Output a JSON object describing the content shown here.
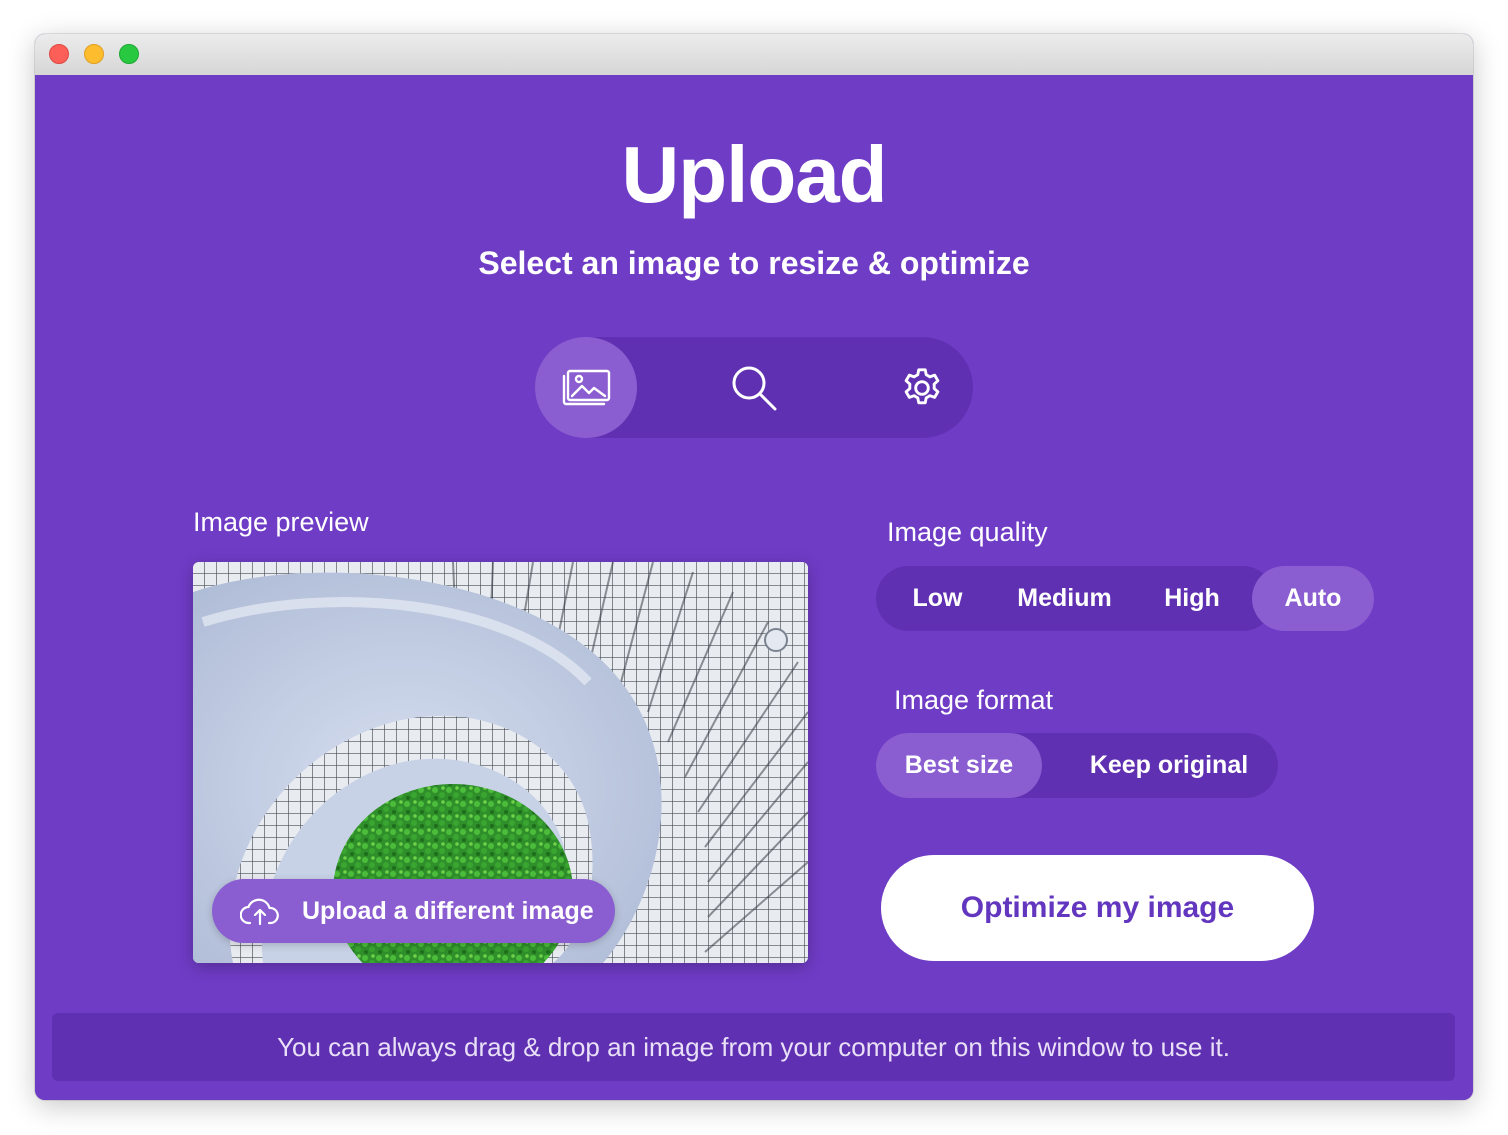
{
  "app": {
    "title": "Upload",
    "subtitle": "Select an image to resize & optimize"
  },
  "tabs": [
    {
      "icon": "image-gallery-icon",
      "active": true
    },
    {
      "icon": "search-icon",
      "active": false
    },
    {
      "icon": "gear-icon",
      "active": false
    }
  ],
  "preview": {
    "label": "Image preview",
    "upload_button_label": "Upload a different image",
    "upload_icon": "cloud-upload-icon"
  },
  "quality": {
    "label": "Image quality",
    "options": [
      "Low",
      "Medium",
      "High",
      "Auto"
    ],
    "selected": "Auto"
  },
  "format": {
    "label": "Image format",
    "options": [
      "Best size",
      "Keep original"
    ],
    "selected": "Best size"
  },
  "actions": {
    "optimize_label": "Optimize my image"
  },
  "footer": {
    "hint": "You can always drag & drop an image from your computer on this window to use it."
  },
  "colors": {
    "background": "#6f3cc6",
    "track": "#5f30b1",
    "active": "#8a5ed1",
    "button_text": "#6336bf"
  }
}
